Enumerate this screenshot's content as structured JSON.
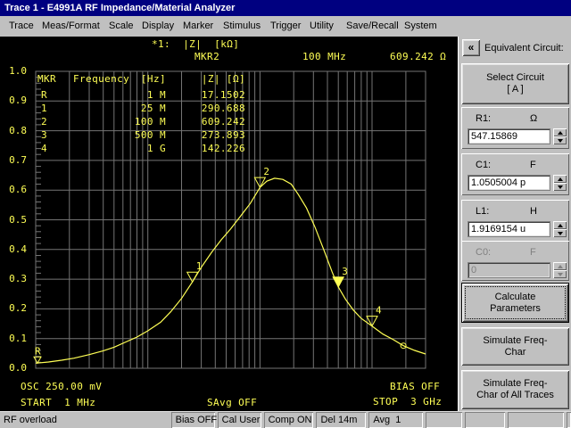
{
  "title_bar": {
    "title": "Trace 1  -  E4991A RF Impedance/Material Analyzer"
  },
  "menu_bar": {
    "items": [
      "Trace",
      "Meas/Format",
      "Scale",
      "Display",
      "Marker",
      "Stimulus",
      "Trigger",
      "Utility",
      "Save/Recall",
      "System"
    ]
  },
  "screen": {
    "trace_format": "*1:  |Z|  [kΩ]",
    "marker_readout": {
      "name": "MKR2",
      "frequency": "100 MHz",
      "value": "609.242 Ω"
    },
    "marker_table": {
      "col_mkr": "MKR",
      "col_frequency": "Frequency",
      "col_hz": "[Hz]",
      "col_z": "|Z| [Ω]",
      "rows": [
        {
          "mkr": "R",
          "freq": "1 M",
          "z": "17.1502"
        },
        {
          "mkr": "1",
          "freq": "25 M",
          "z": "290.688"
        },
        {
          "mkr": "2",
          "freq": "100 M",
          "z": "609.242"
        },
        {
          "mkr": "3",
          "freq": "500 M",
          "z": "273.893"
        },
        {
          "mkr": "4",
          "freq": "1 G",
          "z": "142.226"
        }
      ]
    },
    "osc": "OSC 250.00 mV",
    "bias": "BIAS OFF",
    "start": "START  1 MHz",
    "savg": "SAvg OFF",
    "stop": "STOP  3 GHz"
  },
  "chart_data": {
    "type": "line",
    "title": "*1: |Z| [kΩ]",
    "x_axis": {
      "unit": "MHz",
      "scale": "log",
      "range": [
        1,
        3000
      ],
      "start_label": "START  1 MHz",
      "stop_label": "STOP  3 GHz"
    },
    "y_axis": {
      "unit": "kΩ",
      "scale": "linear",
      "range": [
        0,
        1
      ],
      "tick_labels": [
        "1.0",
        "0.9",
        "0.8",
        "0.7",
        "0.6",
        "0.5",
        "0.4",
        "0.3",
        "0.2",
        "0.1",
        "0.0"
      ]
    },
    "series": [
      {
        "name": "|Z|",
        "points": [
          [
            1,
            0.017
          ],
          [
            1.3,
            0.021
          ],
          [
            1.7,
            0.027
          ],
          [
            2.2,
            0.034
          ],
          [
            3,
            0.046
          ],
          [
            4,
            0.059
          ],
          [
            5,
            0.071
          ],
          [
            6.5,
            0.09
          ],
          [
            8,
            0.105
          ],
          [
            10,
            0.126
          ],
          [
            13,
            0.155
          ],
          [
            16,
            0.19
          ],
          [
            20,
            0.235
          ],
          [
            25,
            0.291
          ],
          [
            30,
            0.34
          ],
          [
            37,
            0.39
          ],
          [
            45,
            0.432
          ],
          [
            55,
            0.47
          ],
          [
            68,
            0.515
          ],
          [
            82,
            0.555
          ],
          [
            100,
            0.609
          ],
          [
            115,
            0.63
          ],
          [
            135,
            0.64
          ],
          [
            160,
            0.636
          ],
          [
            190,
            0.62
          ],
          [
            220,
            0.585
          ],
          [
            260,
            0.54
          ],
          [
            310,
            0.475
          ],
          [
            370,
            0.4
          ],
          [
            440,
            0.325
          ],
          [
            500,
            0.274
          ],
          [
            580,
            0.232
          ],
          [
            680,
            0.196
          ],
          [
            800,
            0.168
          ],
          [
            1000,
            0.142
          ],
          [
            1250,
            0.115
          ],
          [
            1550,
            0.096
          ],
          [
            1900,
            0.076
          ],
          [
            2400,
            0.06
          ],
          [
            3000,
            0.048
          ]
        ]
      }
    ],
    "markers": [
      {
        "id": "R",
        "f_mhz": 1,
        "z_kohm": 0.0171502,
        "filled": false
      },
      {
        "id": "1",
        "f_mhz": 25,
        "z_kohm": 0.290688,
        "filled": false
      },
      {
        "id": "2",
        "f_mhz": 100,
        "z_kohm": 0.609242,
        "filled": false
      },
      {
        "id": "3",
        "f_mhz": 500,
        "z_kohm": 0.273893,
        "filled": true
      },
      {
        "id": "4",
        "f_mhz": 1000,
        "z_kohm": 0.142226,
        "filled": false
      }
    ],
    "aux_marker": {
      "f_mhz": 1900,
      "z_kohm": 0.076
    },
    "grid": true,
    "colors": {
      "trace": "#ffff55",
      "grid": "#757575",
      "bg": "#000000"
    }
  },
  "sidebar": {
    "collapse_button": "«",
    "title": "Equivalent Circuit:",
    "select_circuit": {
      "line1": "Select Circuit",
      "line2": "[ A ]"
    },
    "params": [
      {
        "name": "R1:",
        "unit": "Ω",
        "value": "547.15869",
        "disabled": false
      },
      {
        "name": "C1:",
        "unit": "F",
        "value": "1.0505004 p",
        "disabled": false
      },
      {
        "name": "L1:",
        "unit": "H",
        "value": "1.9169154 u",
        "disabled": false
      },
      {
        "name": "C0:",
        "unit": "F",
        "value": "0",
        "disabled": true
      }
    ],
    "buttons": [
      {
        "id": "calculate-parameters",
        "label": "Calculate Parameters",
        "focused": true
      },
      {
        "id": "simulate-freq-char",
        "label": "Simulate Freq-Char",
        "focused": false
      },
      {
        "id": "simulate-freq-char-all",
        "label": "Simulate Freq-Char of All Traces",
        "focused": false
      }
    ]
  },
  "status_bar": {
    "message": "RF overload",
    "cells": [
      "Bias OFF",
      "Cal User",
      "Comp ON",
      "Del 14m",
      "Avg  1",
      "",
      "",
      "",
      ""
    ]
  }
}
